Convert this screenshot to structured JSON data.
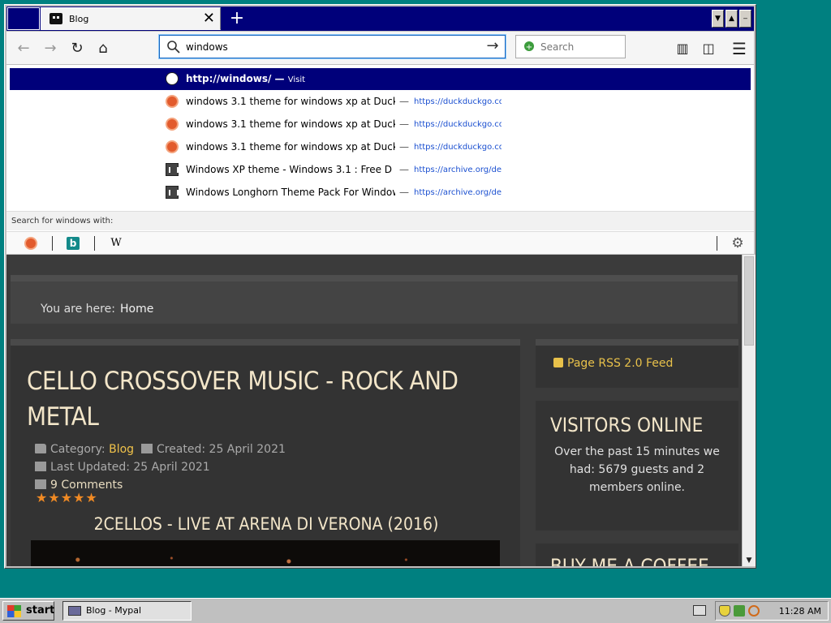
{
  "browser": {
    "tab_title": "Blog",
    "url_value": "windows",
    "search_placeholder": "Search"
  },
  "suggestions": [
    {
      "title": "http://windows/ — ",
      "action": "Visit",
      "url": "",
      "icon": "globe-icon"
    },
    {
      "title": "windows 3.1 theme for windows xp at Duck",
      "url": "https://duckduckgo.co",
      "icon": "duckduckgo-icon"
    },
    {
      "title": "windows 3.1 theme for windows xp at Duck",
      "url": "https://duckduckgo.co",
      "icon": "duckduckgo-icon"
    },
    {
      "title": "windows 3.1 theme for windows xp at Duck",
      "url": "https://duckduckgo.co",
      "icon": "duckduckgo-icon"
    },
    {
      "title": "Windows XP theme - Windows 3.1 : Free D",
      "url": "https://archive.org/de",
      "icon": "archive-icon"
    },
    {
      "title": "Windows Longhorn Theme Pack For Window",
      "url": "https://archive.org/de",
      "icon": "archive-icon"
    }
  ],
  "oneoff": {
    "label": "Search for windows with:",
    "engines": [
      "duckduckgo-icon",
      "bing-icon",
      "wikipedia-icon"
    ],
    "wikipedia_glyph": "W"
  },
  "page": {
    "breadcrumb_label": "You are here:",
    "breadcrumb_home": "Home",
    "article_title": "CELLO CROSSOVER MUSIC - ROCK AND METAL",
    "category_label": "Category:",
    "category": "Blog",
    "created": "Created: 25 April 2021",
    "updated": "Last Updated: 25 April 2021",
    "comments": "9 Comments",
    "rating_stars": 5,
    "video_title": "2CELLOS - LIVE AT ARENA DI VERONA (2016)"
  },
  "sidebar": {
    "rss": "Page RSS 2.0 Feed",
    "visitors_title": "VISITORS ONLINE",
    "visitors_text": "Over the past 15 minutes we had: 5679 guests and 2 members online.",
    "coffee_title": "BUY ME A COFFEE"
  },
  "taskbar": {
    "start": "start",
    "window_button": "Blog - Mypal",
    "clock": "11:28 AM"
  },
  "colors": {
    "titlebar": "#00007a",
    "desktop": "#008080",
    "accent_gold": "#f0c24a",
    "star_orange": "#f08a24"
  }
}
